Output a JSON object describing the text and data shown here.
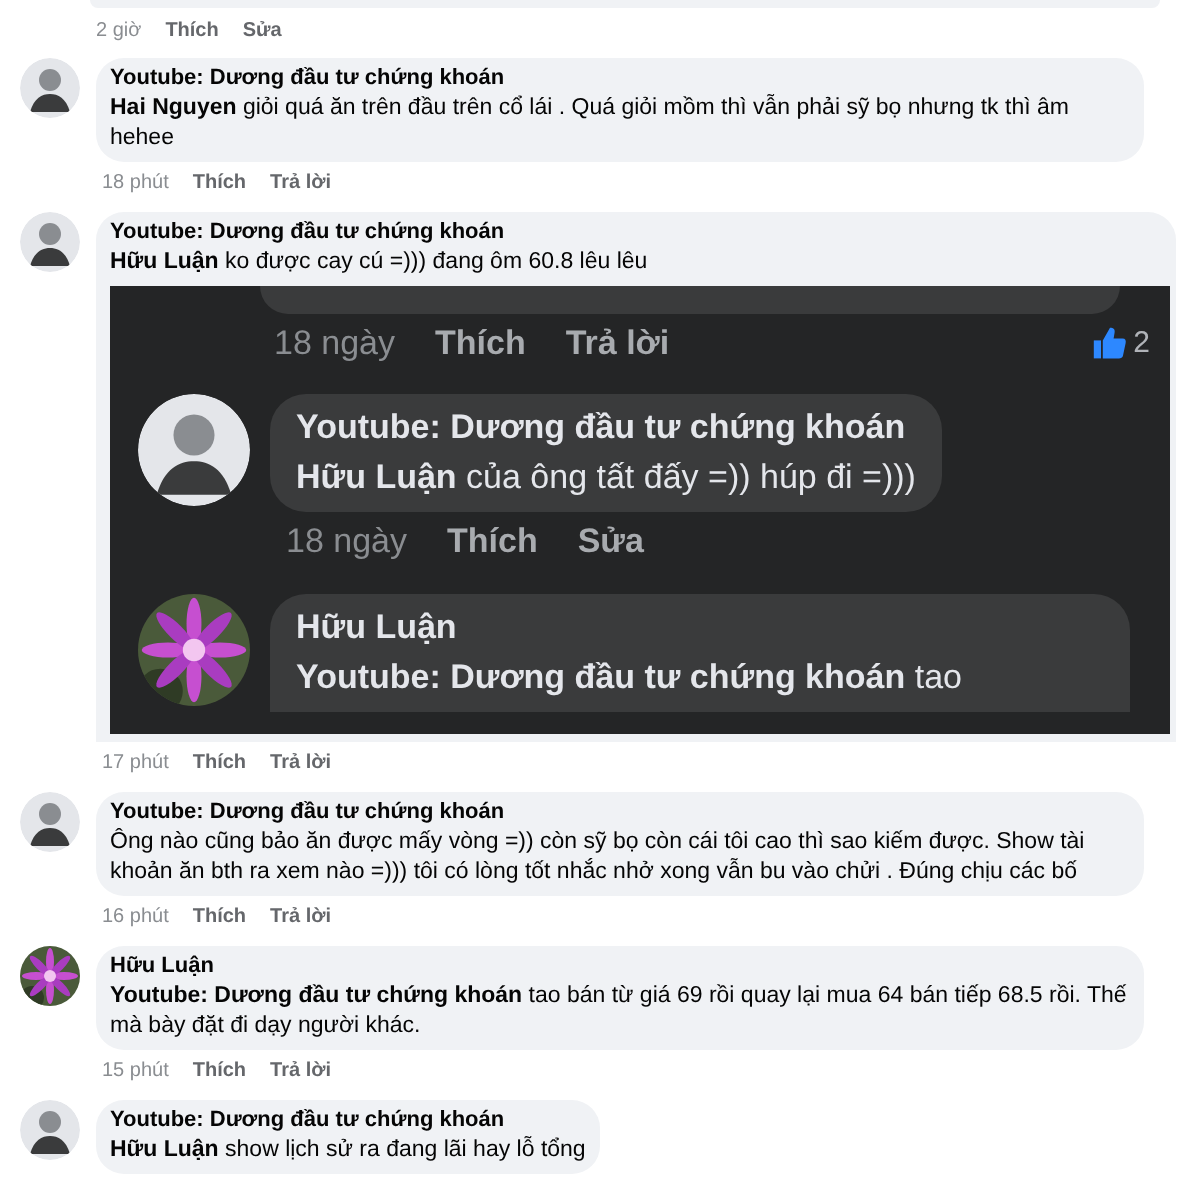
{
  "top_meta": {
    "time": "2 giờ",
    "actions": [
      "Thích",
      "Sửa"
    ]
  },
  "comments": [
    {
      "avatar": {
        "kind": "silhouette"
      },
      "author": "Youtube: Dương đầu tư chứng khoán",
      "text": "**Hai Nguyen**   giỏi quá ăn trên đầu trên cổ lái . Quá giỏi mồm thì vẫn phải sỹ bọ nhưng tk thì âm hehee",
      "time": "18 phút",
      "actions": [
        "Thích",
        "Trả lời"
      ]
    },
    {
      "avatar": {
        "kind": "silhouette"
      },
      "author": "Youtube: Dương đầu tư chứng khoán",
      "text": "**Hữu Luận**  ko được cay cú =))) đang ôm 60.8 lêu lêu",
      "time": "17 phút",
      "actions": [
        "Thích",
        "Trả lời"
      ],
      "attachment": {
        "kind": "screenshot",
        "top_meta": {
          "time": "18 ngày",
          "actions": [
            "Thích",
            "Trả lời"
          ],
          "likes": "2"
        },
        "comments": [
          {
            "avatar": {
              "kind": "silhouette"
            },
            "author": "Youtube: Dương đầu tư chứng khoán",
            "text": "**Hữu Luận**  của ông tất đấy =)) húp đi =)))",
            "time": "18 ngày",
            "actions": [
              "Thích",
              "Sửa"
            ]
          },
          {
            "author": "Hữu Luận",
            "text": "**Youtube: Dương đầu tư chứng khoán**  tao"
          }
        ]
      }
    },
    {
      "avatar": {
        "kind": "silhouette"
      },
      "author": "Youtube: Dương đầu tư chứng khoán",
      "text": "Ông nào cũng bảo ăn được mấy vòng =)) còn sỹ bọ còn cái tôi cao thì sao kiếm được. Show tài khoản ăn bth ra xem nào =))) tôi có lòng tốt nhắc nhở xong vẫn bu vào chửi . Đúng chịu các bố",
      "time": "16 phút",
      "actions": [
        "Thích",
        "Trả lời"
      ]
    },
    {
      "author": "Hữu Luận",
      "text": "**Youtube: Dương đầu tư chứng khoán**  tao bán từ  giá 69 rồi quay lại mua 64 bán tiếp 68.5 rồi. Thế mà bày đặt đi dạy người khác.",
      "time": "15 phút",
      "actions": [
        "Thích",
        "Trả lời"
      ]
    },
    {
      "avatar": {
        "kind": "silhouette"
      },
      "author": "Youtube: Dương đầu tư chứng khoán",
      "text": "**Hữu Luận**  show lịch sử ra đang lãi hay lỗ tổng"
    }
  ]
}
